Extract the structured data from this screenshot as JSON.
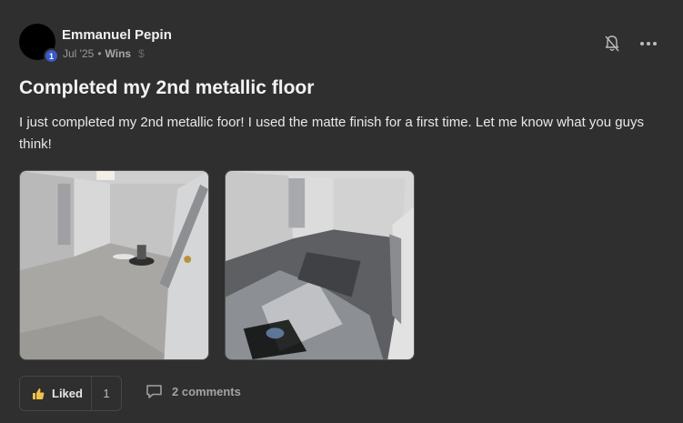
{
  "post": {
    "author": "Emmanuel Pepin",
    "level": "1",
    "date": "Jul '25",
    "separator": "•",
    "category": "Wins",
    "category_icon": "dollar-icon",
    "title": "Completed my 2nd metallic floor",
    "body": "I just completed my 2nd metallic foor! I used the matte finish for a first time. Let me know what you guys think!",
    "images": [
      {
        "alt": "Basement before epoxy - bare concrete floor",
        "icon": "photo"
      },
      {
        "alt": "Basement after metallic epoxy floor",
        "icon": "photo"
      }
    ]
  },
  "actions": {
    "like_label": "Liked",
    "like_count": "1",
    "comments_label": "2 comments"
  },
  "colors": {
    "background": "#2f2f2f",
    "badge": "#3a59c9",
    "like_icon": "#f0c14b"
  }
}
